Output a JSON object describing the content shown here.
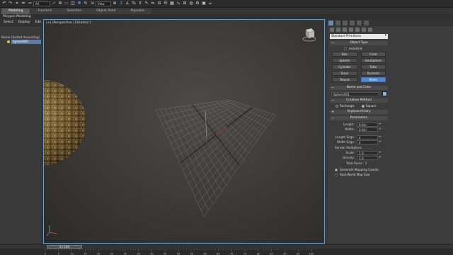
{
  "toolbar": {
    "filter_select": "All",
    "view_select": "View",
    "icons": [
      "undo-icon",
      "redo-icon",
      "link-icon",
      "unlink-icon",
      "bind-icon",
      "filter-select",
      "select-object-icon",
      "select-by-name-icon",
      "rect-select-icon",
      "window-crossing-icon",
      "move-icon",
      "rotate-icon",
      "scale-icon",
      "view-select",
      "pivot-icon",
      "snap-icon",
      "angle-snap-icon",
      "percent-snap-icon",
      "spinner-snap-icon",
      "named-sets-icon",
      "mirror-icon",
      "align-icon",
      "layers-icon",
      "graphite-icon",
      "curve-editor-icon",
      "schematic-icon",
      "material-editor-icon",
      "render-setup-icon",
      "rendered-frame-icon",
      "render-icon"
    ]
  },
  "ribbon": {
    "tabs": [
      "Modeling",
      "Freeform",
      "Selection",
      "Object Paint",
      "Populate"
    ],
    "active_tab": "Modeling",
    "subtitle": "Polygon Modeling"
  },
  "explorer": {
    "menu": [
      "Select",
      "Display",
      "Edit"
    ],
    "header": "Name (Sorted Ascending)",
    "items": [
      {
        "name": "Sphere001"
      }
    ]
  },
  "viewport": {
    "label": "[+] [Perspective ] [Shaded ]"
  },
  "command_panel": {
    "dropdown": "Standard Primitives",
    "object_type": {
      "title": "Object Type",
      "autogrid": "AutoGrid",
      "buttons": [
        "Box",
        "Cone",
        "Sphere",
        "GeoSphere",
        "Cylinder",
        "Tube",
        "Torus",
        "Pyramid",
        "Teapot",
        "Plane"
      ],
      "active": "Plane"
    },
    "name_color": {
      "title": "Name and Color",
      "name_value": "Sphere001",
      "swatch_color": "#8ab9e8"
    },
    "creation_method": {
      "title": "Creation Method",
      "options": [
        "Rectangle",
        "Square"
      ],
      "selected": "Square"
    },
    "keyboard_entry": {
      "title": "Keyboard Entry"
    },
    "parameters": {
      "title": "Parameters",
      "length_label": "Length:",
      "length_value": "0.0m",
      "width_label": "Width:",
      "width_value": "0.0m",
      "length_segs_label": "Length Segs:",
      "length_segs_value": "4",
      "width_segs_label": "Width Segs:",
      "width_segs_value": "4",
      "render_multipliers": "Render Multipliers",
      "scale_label": "Scale:",
      "scale_value": "1.0",
      "density_label": "Density:",
      "density_value": "1.0",
      "total_faces": "Total Faces : 2",
      "gen_mapping": "Generate Mapping Coords.",
      "real_world": "Real-World Map Size",
      "gen_mapping_checked": true,
      "real_world_checked": false
    }
  },
  "timeline": {
    "thumb_label": "0 / 100",
    "ticks": [
      "0",
      "5",
      "10",
      "15",
      "20",
      "25",
      "30",
      "35",
      "40",
      "45",
      "50",
      "55",
      "60",
      "65",
      "70",
      "75",
      "80",
      "85",
      "90",
      "95",
      "100"
    ]
  },
  "colors": {
    "accent": "#4aa3ff",
    "active_button": "#5088d6",
    "grid": "#7a7a7a"
  }
}
